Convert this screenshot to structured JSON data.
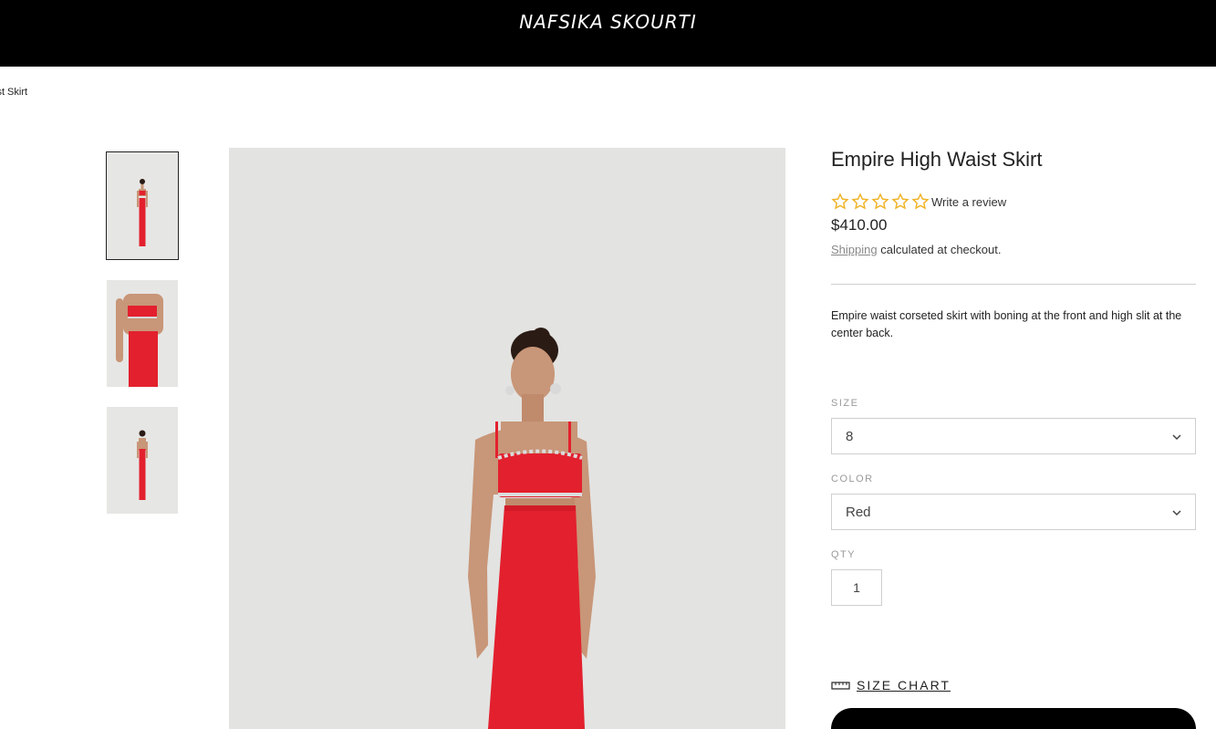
{
  "brand": {
    "logo_text": "NAFSIKA SKOURTI"
  },
  "breadcrumb": "ist Skirt",
  "product": {
    "title": "Empire High Waist Skirt",
    "review_link": "Write a review",
    "rating_stars": 0,
    "price": "$410.00",
    "shipping_link": "Shipping",
    "shipping_text": " calculated at checkout.",
    "description": "Empire waist corseted skirt with boning at the front and high slit at the center back."
  },
  "options": {
    "size_label": "SIZE",
    "size_value": "8",
    "color_label": "COLOR",
    "color_value": "Red",
    "qty_label": "QTY",
    "qty_value": "1"
  },
  "size_chart_label": "SIZE CHART",
  "colors": {
    "accent_star": "#f0b429",
    "dress_red": "#e3202e",
    "header_bg": "#000000"
  },
  "icons": [
    "star-outline-icon",
    "chevron-down-icon",
    "ruler-icon"
  ]
}
